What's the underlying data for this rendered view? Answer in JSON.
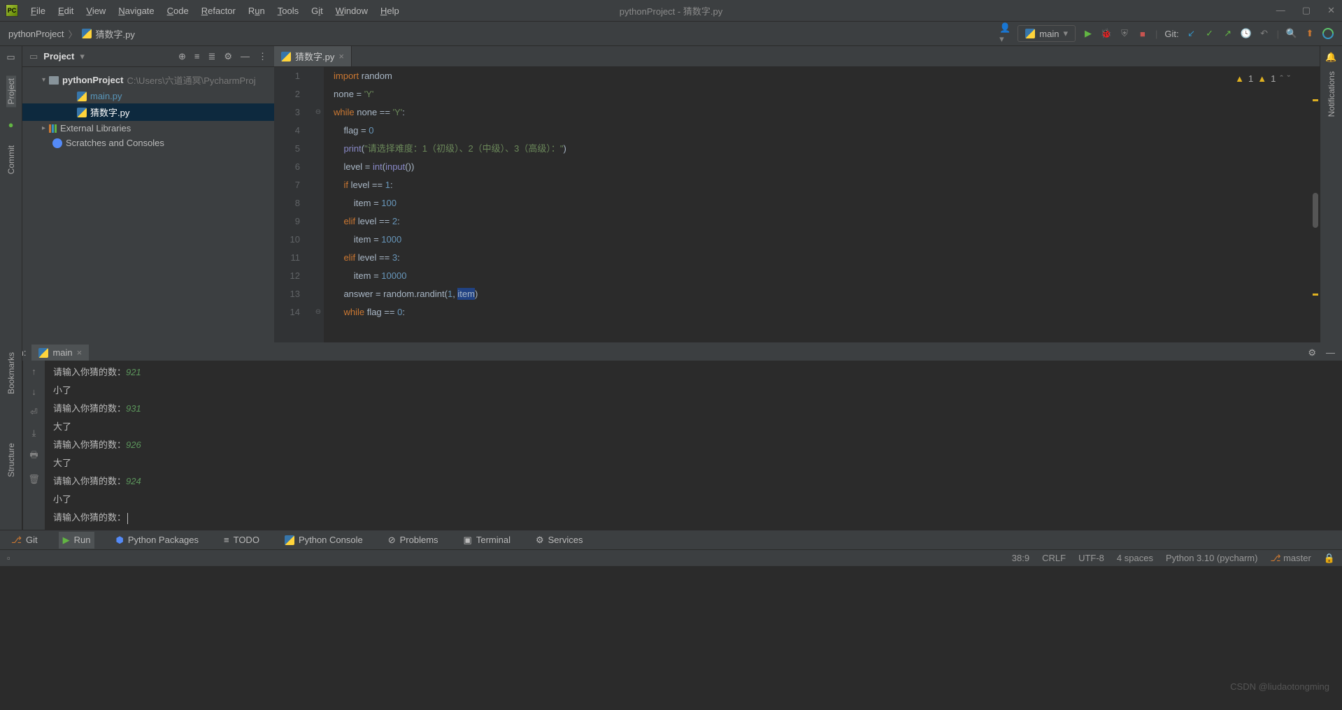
{
  "window": {
    "title": "pythonProject - 猜数字.py"
  },
  "menu": {
    "file": "File",
    "edit": "Edit",
    "view": "View",
    "navigate": "Navigate",
    "code": "Code",
    "refactor": "Refactor",
    "run": "Run",
    "tools": "Tools",
    "git": "Git",
    "window": "Window",
    "help": "Help"
  },
  "breadcrumb": {
    "project": "pythonProject",
    "file": "猜数字.py"
  },
  "runconfig": {
    "name": "main"
  },
  "toolbar": {
    "git_label": "Git:"
  },
  "projectpane": {
    "title": "Project",
    "root_name": "pythonProject",
    "root_path": "C:\\Users\\六道通冥\\PycharmProj",
    "files": [
      "main.py",
      "猜数字.py"
    ],
    "ext_lib": "External Libraries",
    "scratches": "Scratches and Consoles"
  },
  "tabs": {
    "active": "猜数字.py"
  },
  "warnings": {
    "w1": "1",
    "w2": "1"
  },
  "editor": {
    "lines": [
      "1",
      "2",
      "3",
      "4",
      "5",
      "6",
      "7",
      "8",
      "9",
      "10",
      "11",
      "12",
      "13",
      "14"
    ],
    "code": [
      [
        {
          "t": "import ",
          "c": "kw"
        },
        {
          "t": "random",
          "c": "id"
        }
      ],
      [
        {
          "t": "none = ",
          "c": "id"
        },
        {
          "t": "'Y'",
          "c": "str"
        }
      ],
      [
        {
          "t": "while ",
          "c": "kw"
        },
        {
          "t": "none == ",
          "c": "id"
        },
        {
          "t": "'Y'",
          "c": "str"
        },
        {
          "t": ":",
          "c": "id"
        }
      ],
      [
        {
          "t": "    flag = ",
          "c": "id"
        },
        {
          "t": "0",
          "c": "num"
        }
      ],
      [
        {
          "t": "    ",
          "c": "id"
        },
        {
          "t": "print",
          "c": "fn"
        },
        {
          "t": "(",
          "c": "id"
        },
        {
          "t": "\"请选择难度：1（初级）、2（中级）、3（高级）：\"",
          "c": "str"
        },
        {
          "t": ")",
          "c": "id"
        }
      ],
      [
        {
          "t": "    level = ",
          "c": "id"
        },
        {
          "t": "int",
          "c": "fn"
        },
        {
          "t": "(",
          "c": "id"
        },
        {
          "t": "input",
          "c": "fn"
        },
        {
          "t": "())",
          "c": "id"
        }
      ],
      [
        {
          "t": "    ",
          "c": "id"
        },
        {
          "t": "if ",
          "c": "kw"
        },
        {
          "t": "level == ",
          "c": "id"
        },
        {
          "t": "1",
          "c": "num"
        },
        {
          "t": ":",
          "c": "id"
        }
      ],
      [
        {
          "t": "        item = ",
          "c": "id"
        },
        {
          "t": "100",
          "c": "num"
        }
      ],
      [
        {
          "t": "    ",
          "c": "id"
        },
        {
          "t": "elif ",
          "c": "kw"
        },
        {
          "t": "level == ",
          "c": "id"
        },
        {
          "t": "2",
          "c": "num"
        },
        {
          "t": ":",
          "c": "id"
        }
      ],
      [
        {
          "t": "        item = ",
          "c": "id"
        },
        {
          "t": "1000",
          "c": "num"
        }
      ],
      [
        {
          "t": "    ",
          "c": "id"
        },
        {
          "t": "elif ",
          "c": "kw"
        },
        {
          "t": "level == ",
          "c": "id"
        },
        {
          "t": "3",
          "c": "num"
        },
        {
          "t": ":",
          "c": "id"
        }
      ],
      [
        {
          "t": "        item = ",
          "c": "id"
        },
        {
          "t": "10000",
          "c": "num"
        }
      ],
      [
        {
          "t": "    answer = random.randint(",
          "c": "id"
        },
        {
          "t": "1",
          "c": "num"
        },
        {
          "t": ", ",
          "c": "id"
        },
        {
          "t": "item",
          "c": "id",
          "hl": true
        },
        {
          "t": ")",
          "c": "id"
        }
      ],
      [
        {
          "t": "    ",
          "c": "id"
        },
        {
          "t": "while ",
          "c": "kw"
        },
        {
          "t": "flag == ",
          "c": "id"
        },
        {
          "t": "0",
          "c": "num"
        },
        {
          "t": ":",
          "c": "id"
        }
      ]
    ]
  },
  "runpanel": {
    "label": "Run:",
    "tab": "main",
    "output": [
      {
        "prompt": "请输入你猜的数：",
        "inp": "921"
      },
      {
        "text": "小了"
      },
      {
        "prompt": "请输入你猜的数：",
        "inp": "931"
      },
      {
        "text": "大了"
      },
      {
        "prompt": "请输入你猜的数：",
        "inp": "926"
      },
      {
        "text": "大了"
      },
      {
        "prompt": "请输入你猜的数：",
        "inp": "924"
      },
      {
        "text": "小了"
      },
      {
        "prompt": "请输入你猜的数：",
        "cursor": true
      }
    ]
  },
  "sidetabs": {
    "project": "Project",
    "commit": "Commit",
    "bookmarks": "Bookmarks",
    "structure": "Structure",
    "notifications": "Notifications"
  },
  "bottomtabs": {
    "git": "Git",
    "run": "Run",
    "packages": "Python Packages",
    "todo": "TODO",
    "console": "Python Console",
    "problems": "Problems",
    "terminal": "Terminal",
    "services": "Services"
  },
  "status": {
    "pos": "38:9",
    "sep": "CRLF",
    "enc": "UTF-8",
    "indent": "4 spaces",
    "interp": "Python 3.10 (pycharm)",
    "branch": "master"
  },
  "watermark": "CSDN @liudaotongming"
}
